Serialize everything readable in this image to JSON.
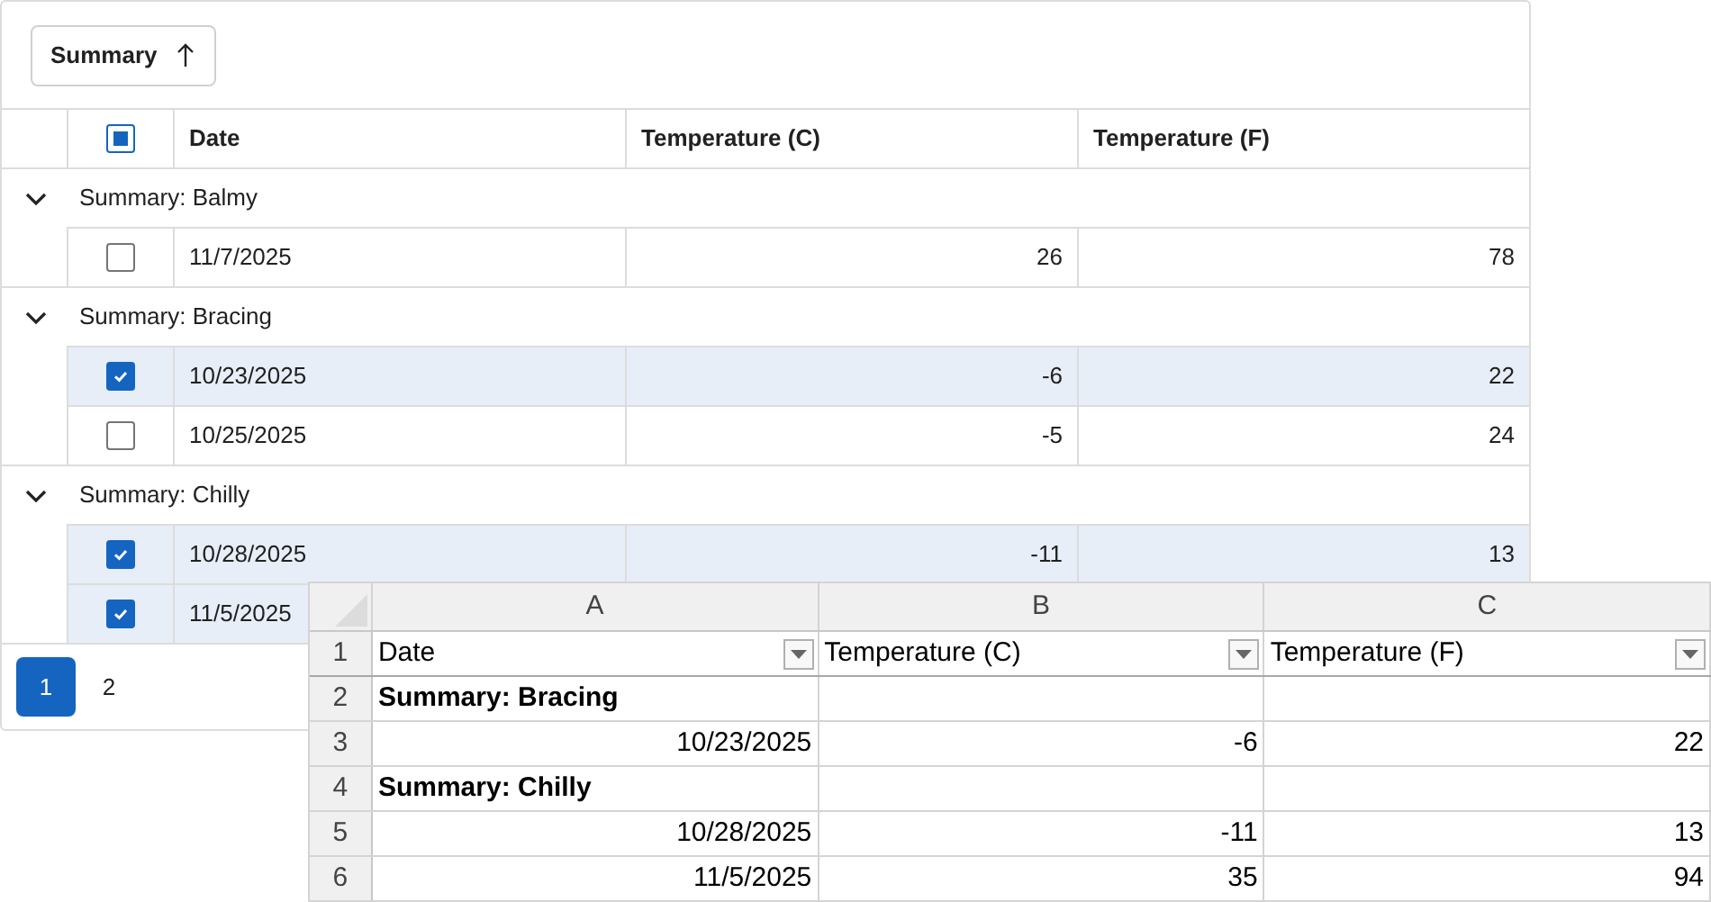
{
  "grid": {
    "group_button": {
      "label": "Summary",
      "sort_ascending": true
    },
    "header_checkbox": {
      "indeterminate": true
    },
    "columns": [
      "Date",
      "Temperature (C)",
      "Temperature (F)"
    ],
    "groups": [
      {
        "label": "Summary: Balmy",
        "expanded": true,
        "rows": [
          {
            "date": "11/7/2025",
            "temp_c": "26",
            "temp_f": "78",
            "selected": false
          }
        ]
      },
      {
        "label": "Summary: Bracing",
        "expanded": true,
        "rows": [
          {
            "date": "10/23/2025",
            "temp_c": "-6",
            "temp_f": "22",
            "selected": true
          },
          {
            "date": "10/25/2025",
            "temp_c": "-5",
            "temp_f": "24",
            "selected": false
          }
        ]
      },
      {
        "label": "Summary: Chilly",
        "expanded": true,
        "rows": [
          {
            "date": "10/28/2025",
            "temp_c": "-11",
            "temp_f": "13",
            "selected": true
          },
          {
            "date": "11/5/2025",
            "selected": true
          }
        ]
      }
    ],
    "pages": [
      {
        "label": "1",
        "selected": true
      },
      {
        "label": "2",
        "selected": false
      }
    ]
  },
  "spreadsheet": {
    "columns": [
      "A",
      "B",
      "C"
    ],
    "rows": [
      {
        "number": "1",
        "kind": "header",
        "cells": [
          "Date",
          "Temperature (C)",
          "Temperature (F)"
        ]
      },
      {
        "number": "2",
        "kind": "group",
        "cells": [
          "Summary: Bracing"
        ]
      },
      {
        "number": "3",
        "kind": "data",
        "cells": [
          "10/23/2025",
          "-6",
          "22"
        ]
      },
      {
        "number": "4",
        "kind": "group",
        "cells": [
          "Summary: Chilly"
        ]
      },
      {
        "number": "5",
        "kind": "data",
        "cells": [
          "10/28/2025",
          "-11",
          "13"
        ]
      },
      {
        "number": "6",
        "kind": "data",
        "cells": [
          "11/5/2025",
          "35",
          "94"
        ]
      }
    ]
  }
}
